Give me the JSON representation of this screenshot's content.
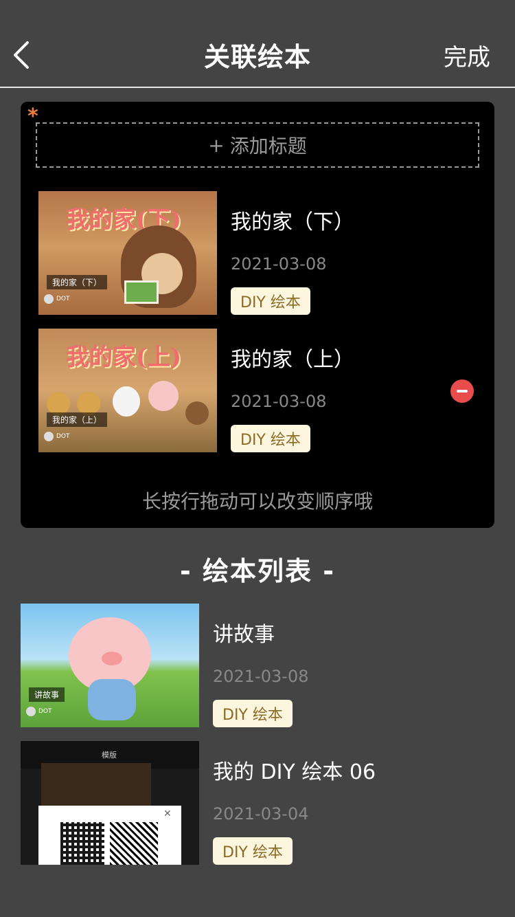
{
  "header": {
    "title": "关联绘本",
    "done_label": "完成",
    "back_icon": "chevron-left-icon"
  },
  "panel": {
    "required_mark": "*",
    "add_title_plus": "+",
    "add_title_label": "添加标题",
    "hint": "长按行拖动可以改变顺序哦",
    "selected": [
      {
        "title": "我的家（下）",
        "date": "2021-03-08",
        "badge": "DIY 绘本",
        "thumb_art_title": "我的家(下)",
        "thumb_label": "我的家（下）",
        "thumb_footer": "DOT"
      },
      {
        "title": "我的家（上）",
        "date": "2021-03-08",
        "badge": "DIY 绘本",
        "thumb_art_title": "我的家(上)",
        "thumb_label": "我的家（上）",
        "thumb_footer": "DOT"
      }
    ]
  },
  "list_section": {
    "title": "-  绘本列表  -",
    "items": [
      {
        "title": "讲故事",
        "date": "2021-03-08",
        "badge": "DIY 绘本",
        "thumb_label": "讲故事",
        "thumb_footer": "DOT"
      },
      {
        "title": "我的 DIY 绘本 06",
        "date": "2021-03-04",
        "badge": "DIY 绘本",
        "thumb_top_text": "模版",
        "thumb_close": "✕"
      }
    ]
  },
  "colors": {
    "background": "#444444",
    "panel": "#000000",
    "badge_bg": "#fdf6df",
    "badge_text": "#8b6a26",
    "remove": "#e84c4c",
    "required": "#f07d3a"
  }
}
